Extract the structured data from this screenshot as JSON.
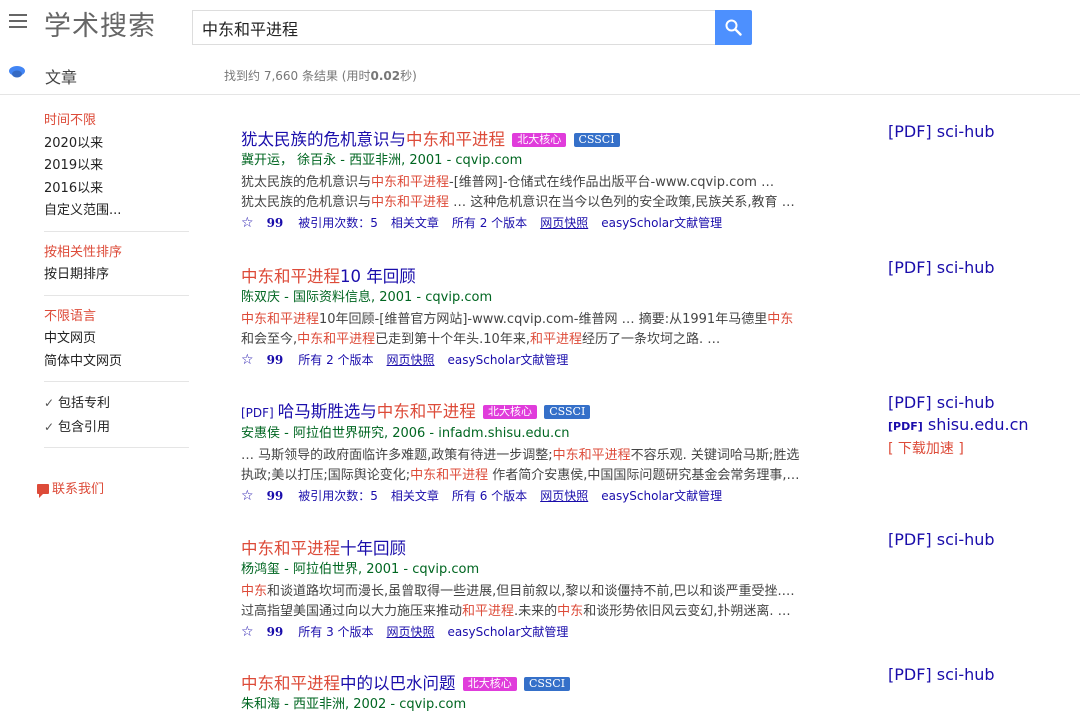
{
  "header": {
    "logo": "学术搜索",
    "query": "中东和平进程"
  },
  "subbar": {
    "section": "文章",
    "stats_prefix": "找到约 7,660 条结果  (用时",
    "stats_time": "0.02",
    "stats_suffix": "秒)"
  },
  "sidebar": {
    "time": [
      "时间不限",
      "2020以来",
      "2019以来",
      "2016以来",
      "自定义范围..."
    ],
    "sort": [
      "按相关性排序",
      "按日期排序"
    ],
    "lang": [
      "不限语言",
      "中文网页",
      "简体中文网页"
    ],
    "checks": [
      "包括专利",
      "包含引用"
    ],
    "contact": "联系我们"
  },
  "results": [
    {
      "title_a": "犹太民族的危机意识与",
      "title_hl": "中东和平进程",
      "title_b": "",
      "badge_core": "北大核心",
      "badge_cssci": "CSSCI",
      "meta": "冀开运，  徐百永 - 西亚非洲, 2001 - cqvip.com",
      "snip1": [
        "犹太民族的危机意识与",
        "中东和平进程",
        "-[维普网]-仓储式在线作品出版平台-www.cqvip.com …"
      ],
      "snip2": [
        "犹太民族的危机意识与",
        "中东和平进程",
        " … 这种危机意识在当今以色列的安全政策,民族关系,教育 …"
      ],
      "cited": "被引用次数：5",
      "related": "相关文章",
      "versions": "所有 2 个版本",
      "snapshot": "网页快照",
      "easyscholar": "easyScholar文献管理",
      "side": [
        "[PDF] sci-hub"
      ]
    },
    {
      "title_hl": "中东和平进程",
      "title_b": "10 年回顾",
      "meta": "陈双庆 - 国际资料信息, 2001 - cqvip.com",
      "snip1": [
        "",
        "中东和平进程",
        "10年回顾-[维普官方网站]-www.cqvip.com-维普网 … 摘要:从1991年马德里",
        "中东"
      ],
      "snip2": [
        "和会至今,",
        "中东和平进程",
        "已走到第十个年头.10年来,",
        "和平进程",
        "经历了一条坎坷之路. …"
      ],
      "versions": "所有 2 个版本",
      "snapshot": "网页快照",
      "easyscholar": "easyScholar文献管理",
      "side": [
        "[PDF] sci-hub"
      ]
    },
    {
      "pdf_tag": "[PDF]",
      "title_a": "哈马斯胜选与",
      "title_hl": "中东和平进程",
      "badge_core": "北大核心",
      "badge_cssci": "CSSCI",
      "meta": "安惠侯 - 阿拉伯世界研究, 2006 - infadm.shisu.edu.cn",
      "snip1": [
        "… 马斯领导的政府面临许多难题,政策有待进一步调整;",
        "中东和平进程",
        "不容乐观. 关键词哈马斯;胜选"
      ],
      "snip2": [
        "执政;美以打压;国际舆论变化;",
        "中东和平进程",
        " 作者简介安惠侯,中国国际问题研究基金会常务理事,…"
      ],
      "cited": "被引用次数：5",
      "related": "相关文章",
      "versions": "所有 6 个版本",
      "snapshot": "网页快照",
      "easyscholar": "easyScholar文献管理",
      "side": [
        "[PDF] sci-hub"
      ],
      "side_pdf_prefix": "[PDF]",
      "side_pdf_host": " shisu.edu.cn",
      "side_download": "[ 下载加速 ]"
    },
    {
      "title_hl": "中东和平进程",
      "title_b": "十年回顾",
      "meta": "杨鸿玺 - 阿拉伯世界, 2001 - cqvip.com",
      "snip1": [
        "",
        "中东",
        "和谈道路坎坷而漫长,虽曾取得一些进展,但目前叙以,黎以和谈僵持不前,巴以和谈严重受挫.…"
      ],
      "snip2": [
        "过高指望美国通过向以大力施压来推动",
        "和平进程",
        ".未来的",
        "中东",
        "和谈形势依旧风云变幻,扑朔迷离. …"
      ],
      "versions": "所有 3 个版本",
      "snapshot": "网页快照",
      "easyscholar": "easyScholar文献管理",
      "side": [
        "[PDF] sci-hub"
      ]
    },
    {
      "title_hl": "中东和平进程",
      "title_b": "中的以巴水问题",
      "badge_core": "北大核心",
      "badge_cssci": "CSSCI",
      "meta": "朱和海 - 西亚非洲, 2002 - cqvip.com",
      "side": [
        "[PDF] sci-hub"
      ]
    }
  ],
  "colors": {
    "accent": "#4d90fe",
    "link": "#1a0dab",
    "highlight": "#dd4b39",
    "url_green": "#006621"
  }
}
